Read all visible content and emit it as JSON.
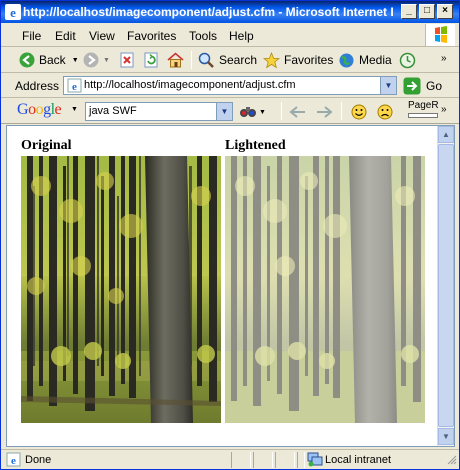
{
  "window": {
    "title": "http://localhost/imagecomponent/adjust.cfm - Microsoft Internet Explorer"
  },
  "menu": {
    "items": [
      {
        "label": "File",
        "key": "F"
      },
      {
        "label": "Edit",
        "key": "E"
      },
      {
        "label": "View",
        "key": "V"
      },
      {
        "label": "Favorites",
        "key": "a"
      },
      {
        "label": "Tools",
        "key": "T"
      },
      {
        "label": "Help",
        "key": "H"
      }
    ]
  },
  "toolbar": {
    "back_label": "Back",
    "search_label": "Search",
    "favorites_label": "Favorites",
    "media_label": "Media"
  },
  "address": {
    "label": "Address",
    "url": "http://localhost/imagecomponent/adjust.cfm",
    "go_label": "Go"
  },
  "google": {
    "logo": "Google",
    "query": "java SWF",
    "pagerank_label": "PageR"
  },
  "content": {
    "original_caption": "Original",
    "lightened_caption": "Lightened"
  },
  "status": {
    "text": "Done",
    "zone": "Local intranet"
  },
  "colors": {
    "titlebar": "#0054e3",
    "chrome": "#ece9d8",
    "google_blue": "#1e4ae3"
  }
}
